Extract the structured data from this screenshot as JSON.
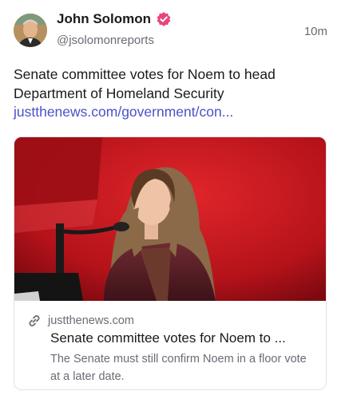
{
  "author": {
    "name": "John Solomon",
    "handle": "@jsolomonreports",
    "verified_badge_icon": "verified-badge-icon",
    "badge_color": "#e8457a"
  },
  "post": {
    "timestamp": "10m",
    "text": "Senate committee votes for Noem to head Department of Homeland Security",
    "link_text": "justthenews.com/government/con..."
  },
  "link_card": {
    "image_icon": "photo-of-speaker-at-podium",
    "link_icon": "link-icon",
    "domain": "justthenews.com",
    "title": "Senate committee votes for Noem to ...",
    "description": "The Senate must still confirm Noem in a floor vote at a later date."
  },
  "colors": {
    "link": "#4a51c9",
    "secondary_text": "#6b6b76",
    "image_background": "#c4161c"
  }
}
